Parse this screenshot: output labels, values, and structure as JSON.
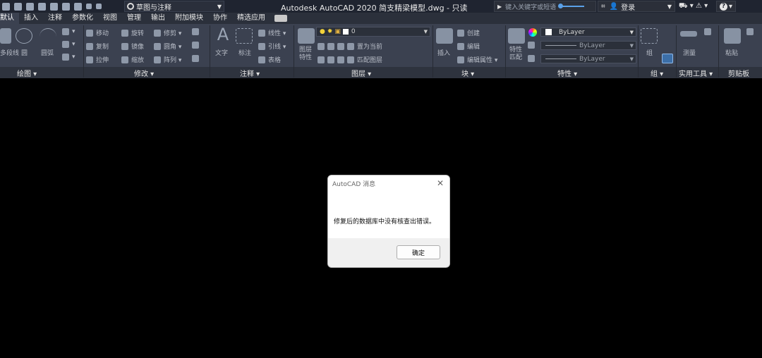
{
  "titlebar": {
    "workspace": "草图与注释",
    "title": "Autodesk AutoCAD 2020    简支精梁模型.dwg - 只读",
    "search_placeholder": "键入关键字或短语",
    "user_label": "登录"
  },
  "tabs": [
    "默认",
    "插入",
    "注释",
    "参数化",
    "视图",
    "管理",
    "输出",
    "附加模块",
    "协作",
    "精选应用"
  ],
  "ribbon": {
    "draw": {
      "title": "绘图 ▾",
      "polyline": "多段线",
      "circle": "圆",
      "arc": "圆弧"
    },
    "modify": {
      "title": "修改 ▾",
      "items": [
        "移动",
        "旋转",
        "修剪 ▾",
        "复制",
        "镜像",
        "圆角 ▾",
        "拉伸",
        "缩放",
        "阵列 ▾"
      ]
    },
    "annotation": {
      "title": "注释 ▾",
      "text": "文字",
      "dimension": "标注",
      "items": [
        "线性 ▾",
        "引线 ▾",
        "表格"
      ]
    },
    "layers": {
      "title": "图层 ▾",
      "layer_props": "图层\n特性",
      "current_layer": "0",
      "items": [
        "置为当前",
        "匹配图层"
      ]
    },
    "block": {
      "title": "块 ▾",
      "insert": "插入",
      "items": [
        "创建",
        "编辑",
        "编辑属性 ▾"
      ]
    },
    "properties": {
      "title": "特性 ▾",
      "match": "特性\n匹配",
      "color": "ByLayer",
      "linetype": "ByLayer",
      "lineweight": "ByLayer"
    },
    "groups": {
      "title": "组 ▾",
      "group": "组"
    },
    "utilities": {
      "title": "实用工具 ▾",
      "measure": "测量"
    },
    "clipboard": {
      "title": "剪贴板",
      "paste": "粘贴"
    }
  },
  "dialog": {
    "title": "AutoCAD 消息",
    "message": "修复后的数据库中没有核查出错误。",
    "ok_label": "确定"
  }
}
